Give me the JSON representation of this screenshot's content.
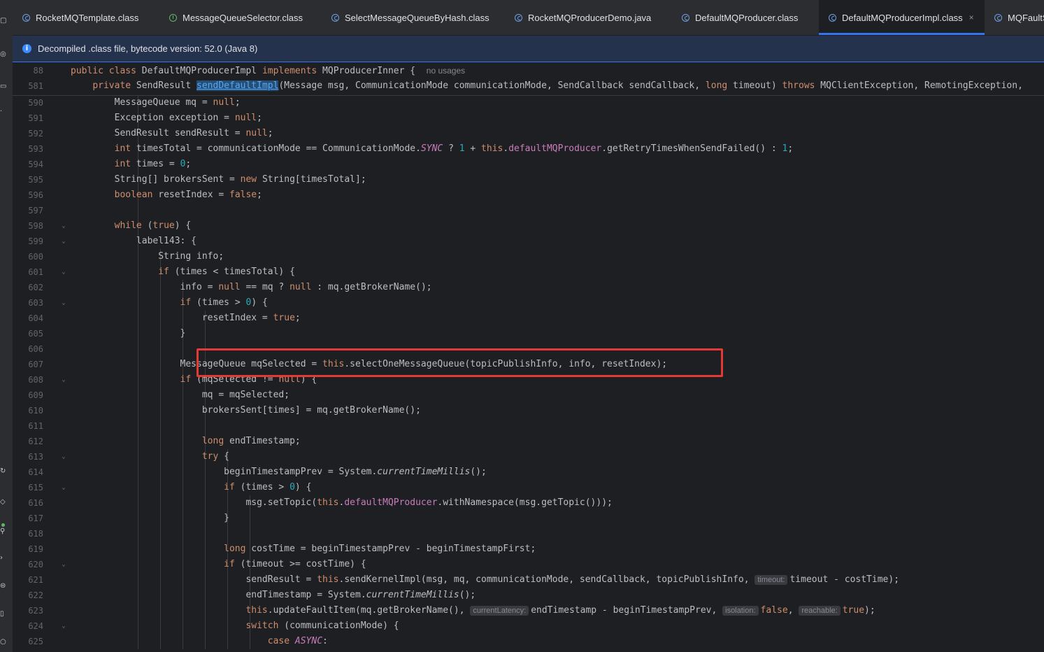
{
  "tabs": [
    {
      "label": "RocketMQTemplate.class",
      "icon": "class-icon",
      "active": false
    },
    {
      "label": "MessageQueueSelector.class",
      "icon": "interface-icon",
      "active": false
    },
    {
      "label": "SelectMessageQueueByHash.class",
      "icon": "class-icon",
      "active": false
    },
    {
      "label": "RocketMQProducerDemo.java",
      "icon": "class-icon",
      "active": false
    },
    {
      "label": "DefaultMQProducer.class",
      "icon": "class-icon",
      "active": false
    },
    {
      "label": "DefaultMQProducerImpl.class",
      "icon": "class-icon",
      "active": true,
      "close": "×"
    },
    {
      "label": "MQFaultS",
      "icon": "class-icon",
      "active": false
    }
  ],
  "banner": {
    "icon": "info-icon",
    "text": "Decompiled .class file, bytecode version: 52.0 (Java 8)"
  },
  "sticky": [
    {
      "ln": "88",
      "code": "public class DefaultMQProducerImpl implements MQProducerInner {",
      "hint": "no usages"
    },
    {
      "ln": "581",
      "code": "    private SendResult sendDefaultImpl(Message msg, CommunicationMode communicationMode, SendCallback sendCallback, long timeout) throws MQClientException, RemotingException,"
    }
  ],
  "lines": [
    {
      "ln": "590",
      "code": "        MessageQueue mq = null;"
    },
    {
      "ln": "591",
      "code": "        Exception exception = null;"
    },
    {
      "ln": "592",
      "code": "        SendResult sendResult = null;"
    },
    {
      "ln": "593",
      "code": "        int timesTotal = communicationMode == CommunicationMode.SYNC ? 1 + this.defaultMQProducer.getRetryTimesWhenSendFailed() : 1;"
    },
    {
      "ln": "594",
      "code": "        int times = 0;"
    },
    {
      "ln": "595",
      "code": "        String[] brokersSent = new String[timesTotal];"
    },
    {
      "ln": "596",
      "code": "        boolean resetIndex = false;"
    },
    {
      "ln": "597",
      "code": ""
    },
    {
      "ln": "598",
      "code": "        while (true) {",
      "fold": true
    },
    {
      "ln": "599",
      "code": "            label143: {",
      "fold": true
    },
    {
      "ln": "600",
      "code": "                String info;"
    },
    {
      "ln": "601",
      "code": "                if (times < timesTotal) {",
      "fold": true
    },
    {
      "ln": "602",
      "code": "                    info = null == mq ? null : mq.getBrokerName();"
    },
    {
      "ln": "603",
      "code": "                    if (times > 0) {",
      "fold": true
    },
    {
      "ln": "604",
      "code": "                        resetIndex = true;"
    },
    {
      "ln": "605",
      "code": "                    }"
    },
    {
      "ln": "606",
      "code": ""
    },
    {
      "ln": "607",
      "code": "                    MessageQueue mqSelected = this.selectOneMessageQueue(topicPublishInfo, info, resetIndex);"
    },
    {
      "ln": "608",
      "code": "                    if (mqSelected != null) {",
      "fold": true
    },
    {
      "ln": "609",
      "code": "                        mq = mqSelected;"
    },
    {
      "ln": "610",
      "code": "                        brokersSent[times] = mq.getBrokerName();"
    },
    {
      "ln": "611",
      "code": ""
    },
    {
      "ln": "612",
      "code": "                        long endTimestamp;"
    },
    {
      "ln": "613",
      "code": "                        try {",
      "fold": true
    },
    {
      "ln": "614",
      "code": "                            beginTimestampPrev = System.currentTimeMillis();"
    },
    {
      "ln": "615",
      "code": "                            if (times > 0) {",
      "fold": true
    },
    {
      "ln": "616",
      "code": "                                msg.setTopic(this.defaultMQProducer.withNamespace(msg.getTopic()));"
    },
    {
      "ln": "617",
      "code": "                            }"
    },
    {
      "ln": "618",
      "code": ""
    },
    {
      "ln": "619",
      "code": "                            long costTime = beginTimestampPrev - beginTimestampFirst;"
    },
    {
      "ln": "620",
      "code": "                            if (timeout >= costTime) {",
      "fold": true
    },
    {
      "ln": "621",
      "code": "                                sendResult = this.sendKernelImpl(msg, mq, communicationMode, sendCallback, topicPublishInfo, timeout - costTime);",
      "inlays": {
        "timeout": "timeout:"
      }
    },
    {
      "ln": "622",
      "code": "                                endTimestamp = System.currentTimeMillis();"
    },
    {
      "ln": "623",
      "code": "                                this.updateFaultItem(mq.getBrokerName(), endTimestamp - beginTimestampPrev, false, true);",
      "inlays": {
        "currentLatency": "currentLatency:",
        "isolation": "isolation:",
        "reachable": "reachable:"
      }
    },
    {
      "ln": "624",
      "code": "                                switch (communicationMode) {",
      "fold": true
    },
    {
      "ln": "625",
      "code": "                                    case ASYNC:"
    }
  ],
  "colors": {
    "keyword": "#cf8e6d",
    "number": "#2aacb8",
    "field": "#c77dbb",
    "method": "#56a8f5",
    "highlight_box": "#e53935",
    "accent": "#3574f0"
  }
}
